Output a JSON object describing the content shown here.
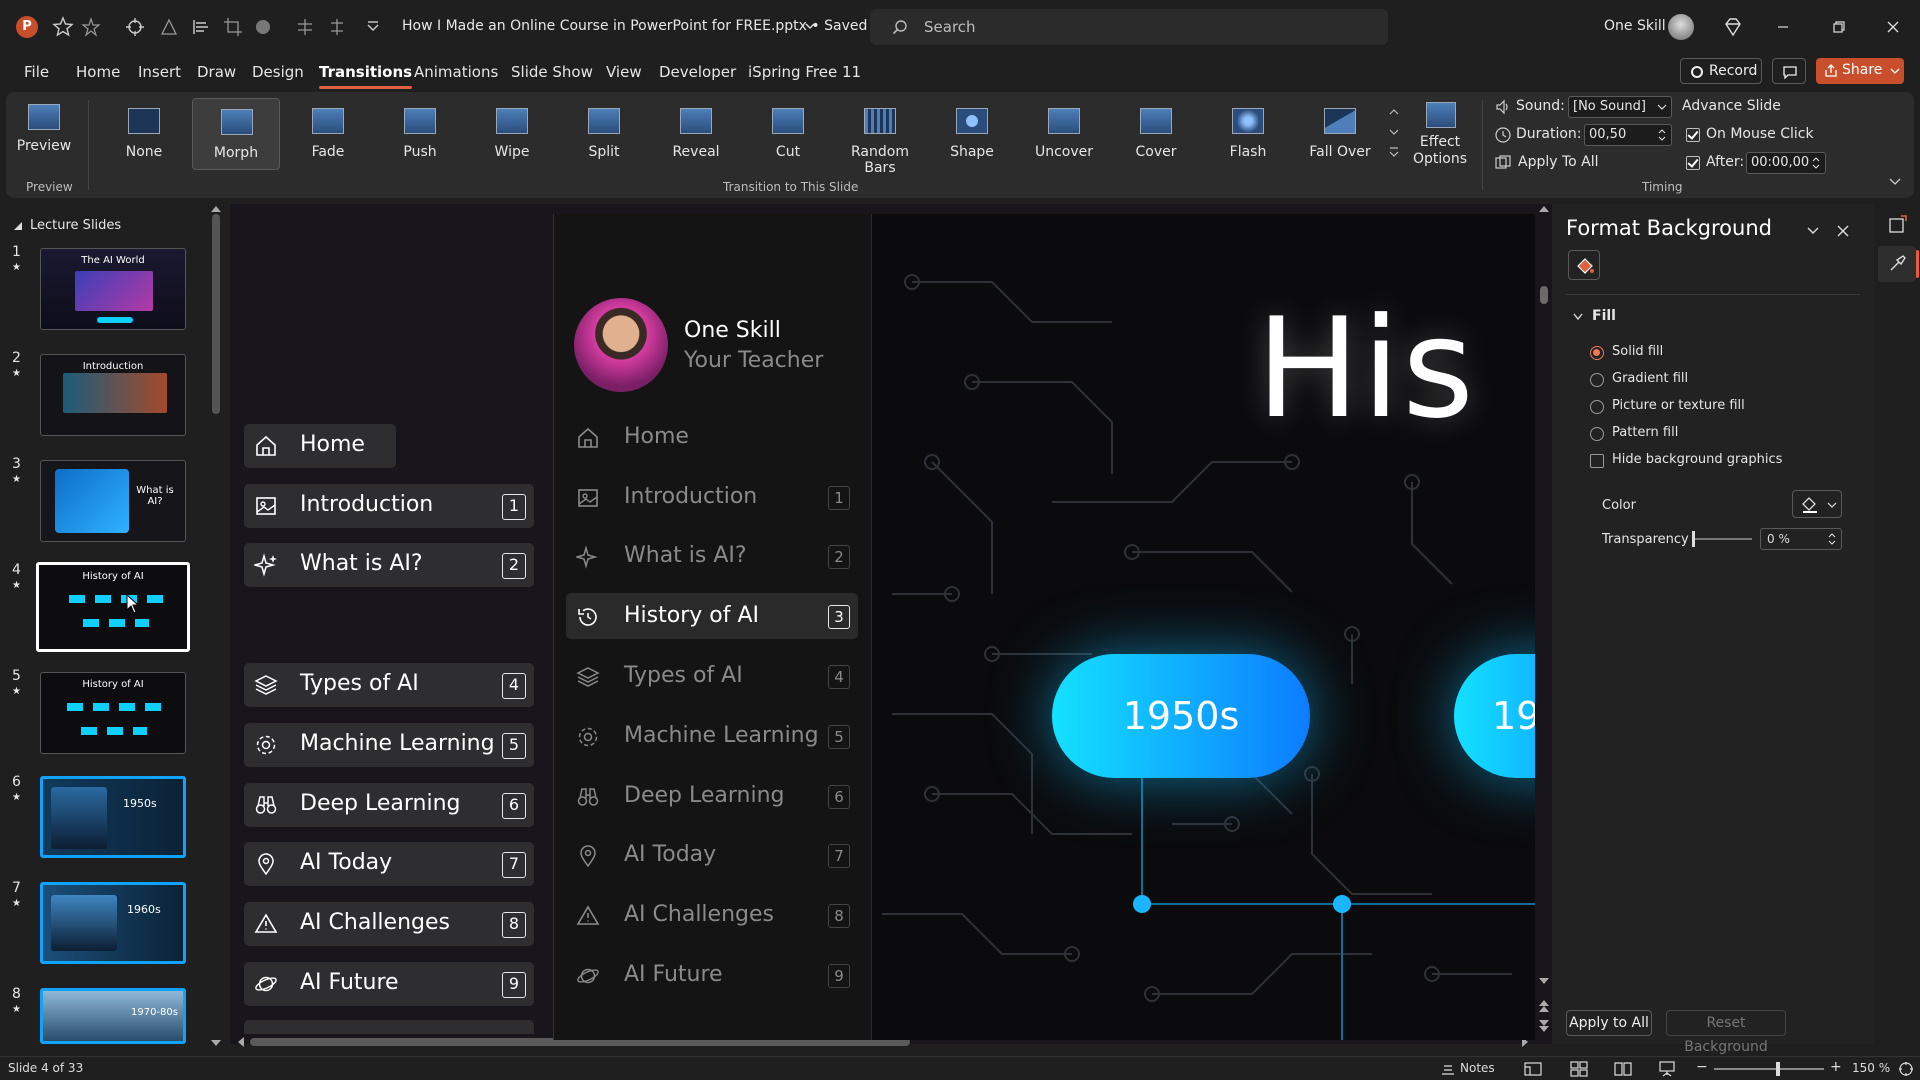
{
  "titlebar": {
    "doc_title": "How I Made an Online Course in PowerPoint for FREE.pptx • Saved",
    "search_placeholder": "Search",
    "user_name": "One Skill"
  },
  "menu": [
    "File",
    "Home",
    "Insert",
    "Draw",
    "Design",
    "Transitions",
    "Animations",
    "Slide Show",
    "View",
    "Developer",
    "iSpring Free 11"
  ],
  "menu_active": "Transitions",
  "menu_right": {
    "record": "Record",
    "share": "Share"
  },
  "ribbon": {
    "preview_label": "Preview",
    "preview_group": "Preview",
    "transitions": [
      "None",
      "Morph",
      "Fade",
      "Push",
      "Wipe",
      "Split",
      "Reveal",
      "Cut",
      "Random Bars",
      "Shape",
      "Uncover",
      "Cover",
      "Flash",
      "Fall Over"
    ],
    "selected_transition": "Morph",
    "effect_options": "Effect Options",
    "transition_group": "Transition to This Slide",
    "sound_label": "Sound:",
    "sound_value": "[No Sound]",
    "duration_label": "Duration:",
    "duration_value": "00,50",
    "apply_all": "Apply To All",
    "advance_slide": "Advance Slide",
    "on_mouse_click": "On Mouse Click",
    "after_label": "After:",
    "after_value": "00:00,00",
    "timing_group": "Timing"
  },
  "slides_panel": {
    "section": "Lecture Slides",
    "slides": [
      {
        "num": "1",
        "caption": "The AI World"
      },
      {
        "num": "2",
        "caption": "Introduction"
      },
      {
        "num": "3",
        "caption": "What is AI?"
      },
      {
        "num": "4",
        "caption": "History of AI"
      },
      {
        "num": "5",
        "caption": "History of AI"
      },
      {
        "num": "6",
        "caption": "1950s"
      },
      {
        "num": "7",
        "caption": "1960s"
      },
      {
        "num": "8",
        "caption": "1970-80s"
      }
    ]
  },
  "canvas_nav": [
    {
      "label": "Home",
      "num": ""
    },
    {
      "label": "Introduction",
      "num": "1"
    },
    {
      "label": "What is AI?",
      "num": "2"
    },
    {
      "label": "Types of AI",
      "num": "4"
    },
    {
      "label": "Machine Learning",
      "num": "5"
    },
    {
      "label": "Deep Learning",
      "num": "6"
    },
    {
      "label": "AI Today",
      "num": "7"
    },
    {
      "label": "AI Challenges",
      "num": "8"
    },
    {
      "label": "AI Future",
      "num": "9"
    }
  ],
  "slide": {
    "teacher_name": "One Skill",
    "teacher_role": "Your Teacher",
    "heading": "His",
    "pill_1950": "1950s",
    "pill_next": "19",
    "nav": [
      {
        "label": "Home",
        "num": ""
      },
      {
        "label": "Introduction",
        "num": "1"
      },
      {
        "label": "What is AI?",
        "num": "2"
      },
      {
        "label": "History of AI",
        "num": "3"
      },
      {
        "label": "Types of AI",
        "num": "4"
      },
      {
        "label": "Machine Learning",
        "num": "5"
      },
      {
        "label": "Deep Learning",
        "num": "6"
      },
      {
        "label": "AI Today",
        "num": "7"
      },
      {
        "label": "AI Challenges",
        "num": "8"
      },
      {
        "label": "AI Future",
        "num": "9"
      }
    ],
    "active_nav": "History of AI"
  },
  "format_pane": {
    "title": "Format Background",
    "fill_header": "Fill",
    "options": [
      "Solid fill",
      "Gradient fill",
      "Picture or texture fill",
      "Pattern fill"
    ],
    "selected": "Solid fill",
    "hide_bg": "Hide background graphics",
    "color_label": "Color",
    "transparency_label": "Transparency",
    "transparency_value": "0 %",
    "transparency_level": 0,
    "apply_all": "Apply to All",
    "reset": "Reset Background"
  },
  "status": {
    "slide_info": "Slide 4 of 33",
    "notes": "Notes",
    "zoom": "150 %"
  },
  "colors": {
    "accent": "#e0603f",
    "cyan": "#0fcfff",
    "share": "#c94f2c"
  }
}
